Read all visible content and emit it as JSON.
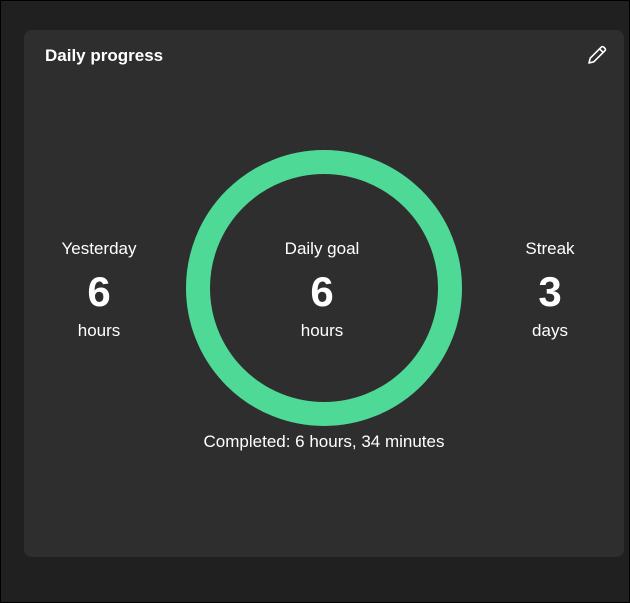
{
  "card": {
    "title": "Daily progress",
    "edit_icon": "pencil-icon"
  },
  "yesterday": {
    "label": "Yesterday",
    "value": "6",
    "unit": "hours"
  },
  "goal": {
    "label": "Daily goal",
    "value": "6",
    "unit": "hours"
  },
  "streak": {
    "label": "Streak",
    "value": "3",
    "unit": "days"
  },
  "progress": {
    "fraction_complete": 1.0,
    "completed_text": "Completed: 6 hours, 34 minutes"
  },
  "colors": {
    "ring": "#4fd997",
    "card_bg": "#2e2e2e",
    "text": "#ffffff"
  }
}
